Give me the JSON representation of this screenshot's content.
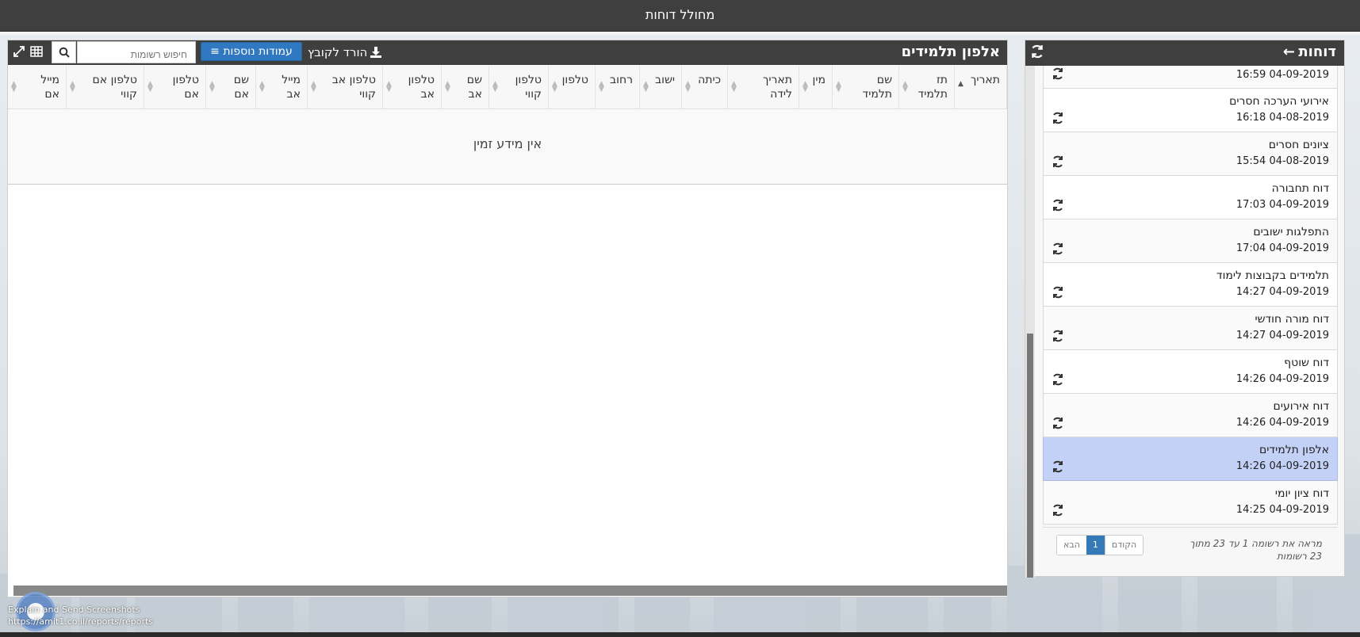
{
  "topbar": {
    "title": "מחולל דוחות"
  },
  "reports_panel": {
    "title": "דוחות",
    "items": [
      {
        "name": "",
        "date": "16:59 04-09-2019"
      },
      {
        "name": "אירועי הערכה חסרים",
        "date": "16:18 04-08-2019"
      },
      {
        "name": "ציונים חסרים",
        "date": "15:54 04-08-2019"
      },
      {
        "name": "דוח תחבורה",
        "date": "17:03 04-09-2019"
      },
      {
        "name": "התפלגות ישובים",
        "date": "17:04 04-09-2019"
      },
      {
        "name": "תלמידים בקבוצות לימוד",
        "date": "14:27 04-09-2019"
      },
      {
        "name": "דוח מורה חודשי",
        "date": "14:27 04-09-2019"
      },
      {
        "name": "דוח שוטף",
        "date": "14:26 04-09-2019"
      },
      {
        "name": "דוח אירועים",
        "date": "14:26 04-09-2019"
      },
      {
        "name": "אלפון תלמידים",
        "date": "14:26 04-09-2019",
        "selected": true
      },
      {
        "name": "דוח ציון יומי",
        "date": "14:25 04-09-2019"
      }
    ],
    "footer_info": "מראה את רשומה 1 עד 23 מתוך 23 רשומות",
    "pager": {
      "prev": "הקודם",
      "page": "1",
      "next": "הבא"
    }
  },
  "main_panel": {
    "title": "אלפון תלמידים",
    "download_label": "הורד לקובץ",
    "columns_button": "עמודות נוספות",
    "search_placeholder": "חיפוש רשומות",
    "columns": [
      "תאריך",
      "תז\nתלמיד",
      "שם\nתלמיד",
      "מין",
      "תאריך\nלידה",
      "כיתה",
      "ישוב",
      "רחוב",
      "טלפון",
      "טלפון\nקווי",
      "שם\nאב",
      "טלפון\nאב",
      "טלפון אב\nקווי",
      "מייל\nאב",
      "שם\nאם",
      "טלפון\nאם",
      "טלפון אם\nקווי",
      "מייל\nאם"
    ],
    "empty_message": "אין מידע זמין"
  },
  "overlay": {
    "explain_text": "Explain and Send Screenshots",
    "url": "https://amit1.co.il/reports/reports"
  },
  "colors": {
    "header_bg": "#3f3f3f",
    "selected_row": "#c4d1f7",
    "primary_button": "#3079c2"
  }
}
